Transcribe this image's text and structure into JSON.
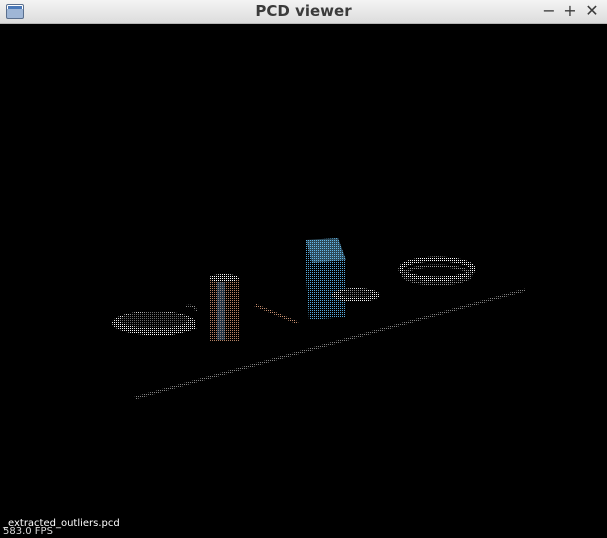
{
  "window": {
    "title": "PCD viewer",
    "icon": "window-icon",
    "controls": {
      "minimize": "−",
      "maximize": "+",
      "close": "✕"
    }
  },
  "viewer": {
    "background_color": "#000000",
    "cloud_name": "_extracted_outliers.pcd",
    "fps": "583.0 FPS"
  }
}
